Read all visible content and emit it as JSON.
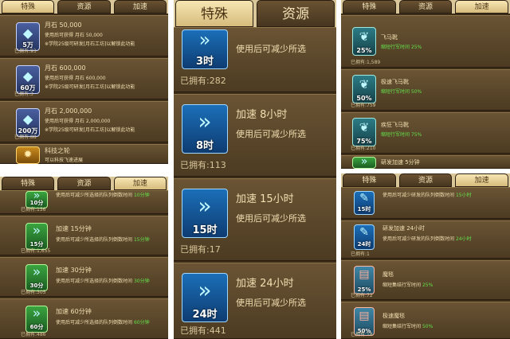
{
  "p1": {
    "tabs": [
      "特殊",
      "资源",
      "加速"
    ],
    "rows": [
      {
        "cap": "5万",
        "title": "月石 50,000",
        "desc": "使用后可获得 月石 50,000",
        "note": "※学院25级可研发[月石工坊]以解锁此功能",
        "own": "已拥有:93"
      },
      {
        "cap": "60万",
        "title": "月石 600,000",
        "desc": "使用后可获得 月石 600,000",
        "note": "※学院25级可研发[月石工坊]以解锁此功能",
        "own": "已拥有:3"
      },
      {
        "cap": "200万",
        "title": "月石 2,000,000",
        "desc": "使用后可获得 月石 2,000,000",
        "note": "※学院25级可研发[月石工坊]以解锁此功能",
        "own": "已拥有:88"
      },
      {
        "cap": "",
        "title": "科技之轮",
        "desc": "可以科技飞速进展",
        "note": "",
        "own": ""
      }
    ]
  },
  "p2": {
    "tabs": [
      "特殊",
      "资源"
    ],
    "rows": [
      {
        "cap": "3时",
        "title": "",
        "desc": "使用后可减少所选",
        "own": "已拥有:282"
      },
      {
        "cap": "8时",
        "title": "加速 8小时",
        "desc": "使用后可减少所选",
        "own": "已拥有:113"
      },
      {
        "cap": "15时",
        "title": "加速 15小时",
        "desc": "使用后可减少所选",
        "own": "已拥有:17"
      },
      {
        "cap": "24时",
        "title": "加速 24小时",
        "desc": "使用后可减少所选",
        "own": "已拥有:441"
      }
    ]
  },
  "p3": {
    "tabs": [
      "特殊",
      "资源",
      "加速"
    ],
    "rows": [
      {
        "cap": "25%",
        "title": "飞马靴",
        "desc": "缩短行军时间 25%",
        "own": "已拥有:1,589"
      },
      {
        "cap": "50%",
        "title": "极速飞马靴",
        "desc": "缩短行军时间 50%",
        "own": "已拥有:759"
      },
      {
        "cap": "75%",
        "title": "疾狂飞马靴",
        "desc": "缩短行军时间 75%",
        "own": "已拥有:210"
      },
      {
        "cap": "",
        "title": "研发加速 5分钟",
        "desc": "",
        "own": ""
      }
    ]
  },
  "p4": {
    "tabs": [
      "特殊",
      "资源",
      "加速"
    ],
    "rows": [
      {
        "cap": "10分",
        "title": "",
        "desc": "使用后可减少所选择的队列倒数时间",
        "g": "10分钟",
        "own": "已拥有:156"
      },
      {
        "cap": "15分",
        "title": "加速 15分钟",
        "desc": "使用后可减少所选择的队列倒数时间",
        "g": "15分钟",
        "own": "已拥有:1,655"
      },
      {
        "cap": "30分",
        "title": "加速 30分钟",
        "desc": "使用后可减少所选择的队列倒数时间",
        "g": "30分钟",
        "own": "已拥有:305"
      },
      {
        "cap": "60分",
        "title": "加速 60分钟",
        "desc": "使用后可减少所选择的队列倒数时间",
        "g": "60分钟",
        "own": "已拥有:486"
      }
    ]
  },
  "p5": {
    "tabs": [
      "特殊",
      "资源",
      "加速"
    ],
    "rows": [
      {
        "cap": "15时",
        "title": "",
        "desc": "使用后可减少研发的队列倒数时间",
        "g": "15小时",
        "own": ""
      },
      {
        "cap": "24时",
        "title": "研发加速 24小时",
        "desc": "使用后可减少研发的队列倒数时间",
        "g": "24小时",
        "own": "已拥有:1"
      },
      {
        "cap": "25%",
        "title": "魔毯",
        "desc": "缩短集结行军时间",
        "g": "25%",
        "own": "已拥有:72"
      },
      {
        "cap": "50%",
        "title": "极速魔毯",
        "desc": "缩短集结行军时间",
        "g": "50%",
        "own": "已拥有:18"
      }
    ]
  }
}
